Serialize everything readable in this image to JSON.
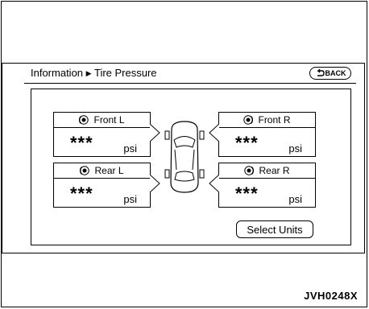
{
  "header": {
    "breadcrumb_parent": "Information",
    "breadcrumb_arrow": "▶",
    "breadcrumb_current": "Tire Pressure",
    "back_label": "BACK"
  },
  "tires": {
    "front_left": {
      "label": "Front L",
      "value": "***",
      "unit": "psi"
    },
    "front_right": {
      "label": "Front R",
      "value": "***",
      "unit": "psi"
    },
    "rear_left": {
      "label": "Rear L",
      "value": "***",
      "unit": "psi"
    },
    "rear_right": {
      "label": "Rear R",
      "value": "***",
      "unit": "psi"
    }
  },
  "buttons": {
    "select_units": "Select Units"
  },
  "figure_id": "JVH0248X",
  "icons": {
    "back": "back-arrow-icon",
    "tire": "tire-icon",
    "car": "car-top-view-icon"
  }
}
